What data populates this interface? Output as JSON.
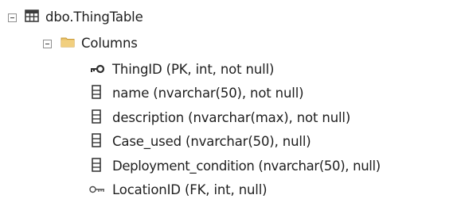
{
  "table_node": {
    "label": "dbo.ThingTable",
    "icon": "table-icon",
    "expanded": true
  },
  "columns_folder": {
    "label": "Columns",
    "icon": "folder-icon",
    "expanded": true
  },
  "columns": [
    {
      "label": "ThingID (PK, int, not null)",
      "icon": "primary-key-icon"
    },
    {
      "label": "name (nvarchar(50), not null)",
      "icon": "column-icon"
    },
    {
      "label": "description (nvarchar(max), not null)",
      "icon": "column-icon"
    },
    {
      "label": "Case_used (nvarchar(50), null)",
      "icon": "column-icon"
    },
    {
      "label": "Deployment_condition (nvarchar(50), null)",
      "icon": "column-icon"
    },
    {
      "label": "LocationID (FK, int, null)",
      "icon": "foreign-key-icon"
    }
  ],
  "colors": {
    "folder": "#e8c26a",
    "table_icon": "#3c3c3c",
    "text": "#1e1e1e"
  }
}
